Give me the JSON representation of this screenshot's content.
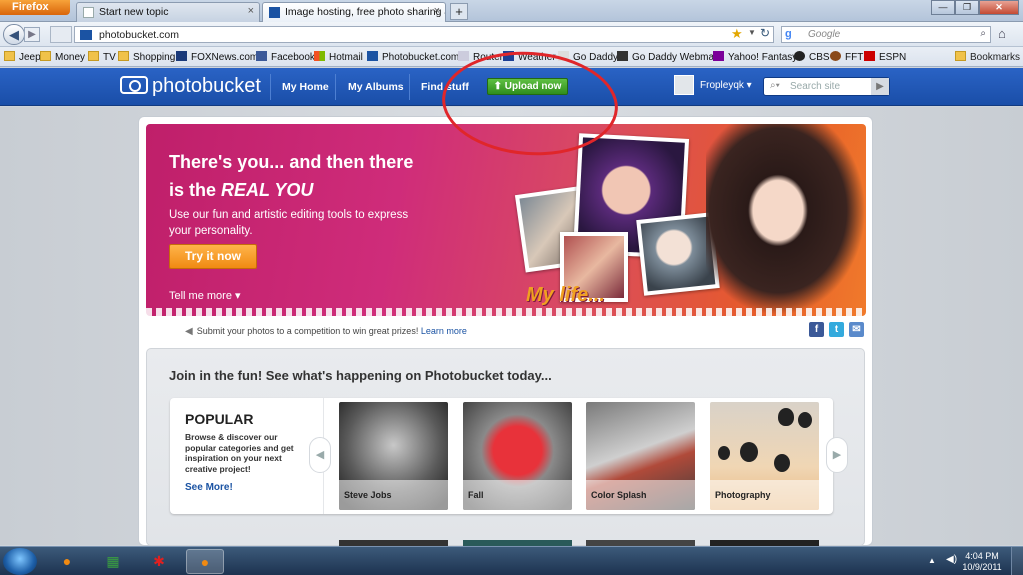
{
  "browser": {
    "menu_label": "Firefox",
    "tabs": [
      {
        "label": "Start new topic",
        "close": "×"
      },
      {
        "label": "Image hosting, free photo sharing & ...",
        "close": "×"
      }
    ],
    "new_tab": "+",
    "url": "photobucket.com",
    "search_placeholder": "Google",
    "bookmarks": [
      "Jeep",
      "Money",
      "TV",
      "Shopping",
      "FOXNews.com",
      "Facebook",
      "Hotmail",
      "Photobucket.com",
      "Router",
      "Weather",
      "Go Daddy",
      "Go Daddy Webmail",
      "Yahoo! Fantasy",
      "CBS",
      "FFT",
      "ESPN"
    ],
    "bookmarks_menu": "Bookmarks"
  },
  "pb": {
    "logo": "photobucket",
    "nav": [
      "My Home",
      "My Albums",
      "Find stuff"
    ],
    "upload": "Upload now",
    "user": "Fropleyqk",
    "site_search_placeholder": "Search site"
  },
  "hero": {
    "title_line1": "There's you... and then there",
    "title_line2_prefix": "is the ",
    "title_emphasis": "REAL YOU",
    "subtitle": "Use our fun and artistic editing tools to express your personality.",
    "cta": "Try it now",
    "more": "Tell me more",
    "art_text": "My life..."
  },
  "promo": {
    "text": "Submit your photos to a competition to win great prizes!",
    "link": "Learn more"
  },
  "join": {
    "title": "Join in the fun! See what's happening on Photobucket today...",
    "section_title": "POPULAR",
    "section_desc": "Browse & discover our popular categories and get inspiration on your next creative project!",
    "see_more": "See More!",
    "categories": [
      "Steve Jobs",
      "Fall",
      "Color Splash",
      "Photography"
    ]
  },
  "taskbar": {
    "time": "4:04 PM",
    "date": "10/9/2011"
  },
  "colors": {
    "pb_blue": "#1a4ea8",
    "upload_green": "#3a9c22",
    "cta_orange": "#f08a12",
    "annotation_red": "#e0262a",
    "link_blue": "#1b53a3"
  }
}
